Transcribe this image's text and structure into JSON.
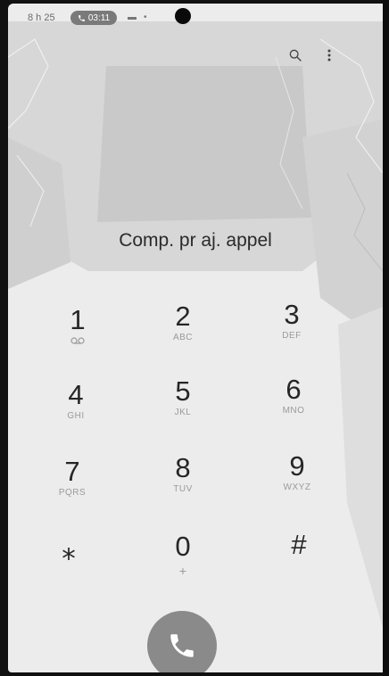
{
  "status": {
    "time": "8 h 25",
    "call_timer": "03:11"
  },
  "toolbar": {
    "search_icon": "search-icon",
    "more_icon": "more-vertical-icon"
  },
  "prompt": "Comp. pr aj. appel",
  "keypad": [
    {
      "digit": "1",
      "letters": ""
    },
    {
      "digit": "2",
      "letters": "ABC"
    },
    {
      "digit": "3",
      "letters": "DEF"
    },
    {
      "digit": "4",
      "letters": "GHI"
    },
    {
      "digit": "5",
      "letters": "JKL"
    },
    {
      "digit": "6",
      "letters": "MNO"
    },
    {
      "digit": "7",
      "letters": "PQRS"
    },
    {
      "digit": "8",
      "letters": "TUV"
    },
    {
      "digit": "9",
      "letters": "WXYZ"
    },
    {
      "digit": "⁎",
      "letters": ""
    },
    {
      "digit": "0",
      "letters": "+"
    },
    {
      "digit": "#",
      "letters": ""
    }
  ],
  "colors": {
    "screen": "#ececec",
    "call_button": "#8a8a8a",
    "call_pill": "#7a7a7a"
  }
}
